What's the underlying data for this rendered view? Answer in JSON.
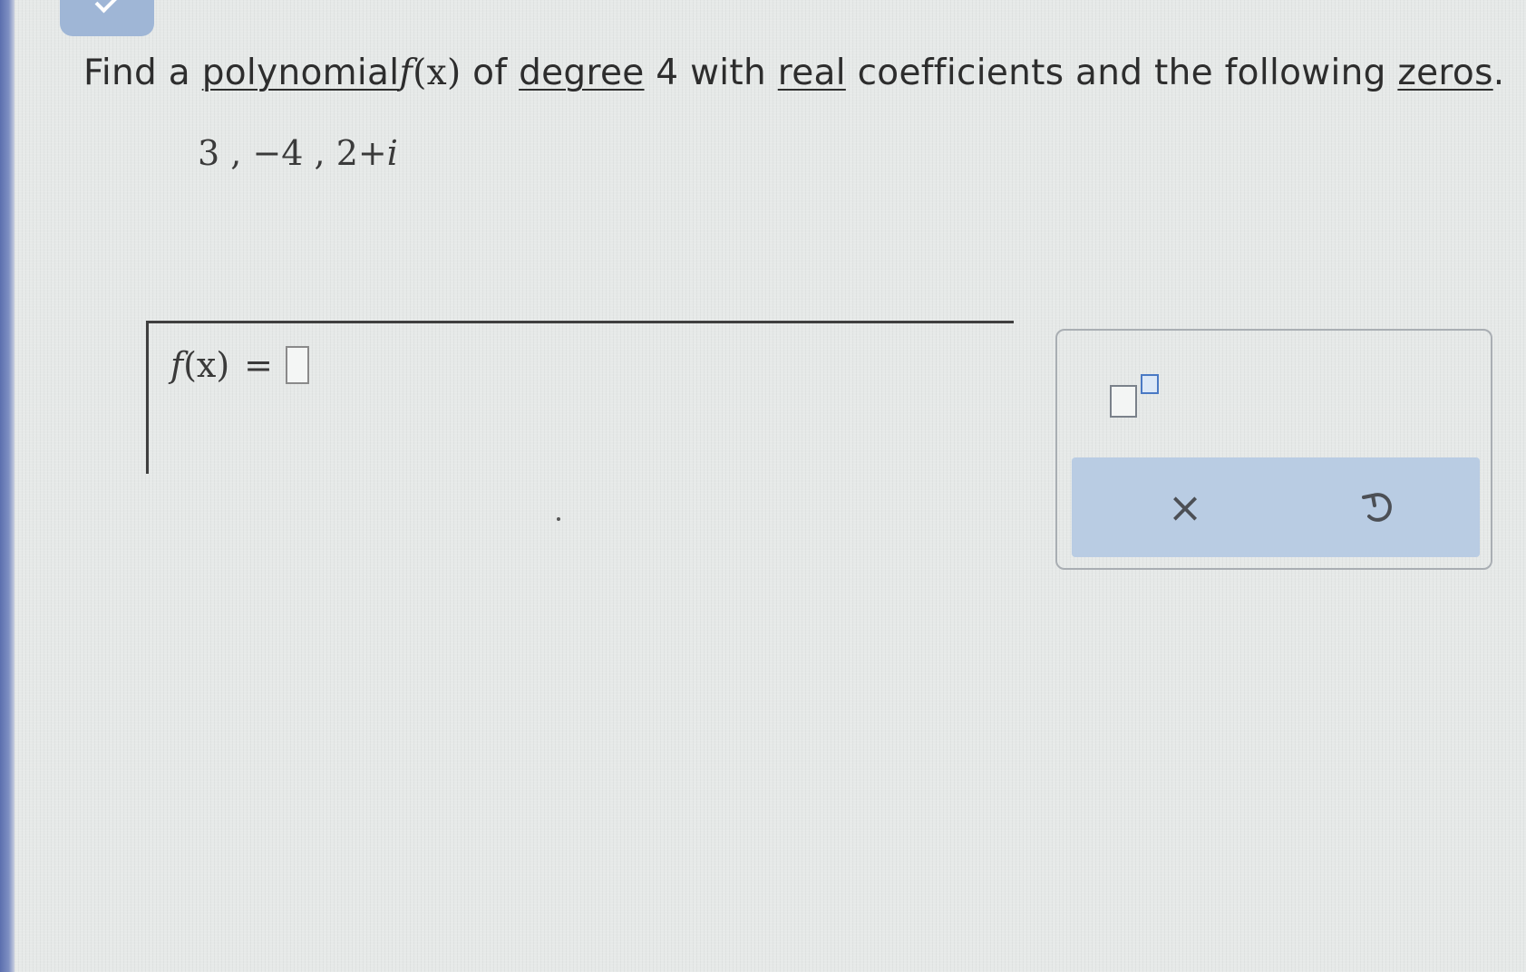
{
  "question": {
    "text_before": "Find a",
    "link_polynomial": "polynomial",
    "func_f": "f",
    "func_x": "(x)",
    "text_of": "of",
    "link_degree": "degree",
    "degree_value": "4",
    "text_with": "with",
    "link_real": "real",
    "text_coeffs": "coefficients and the following",
    "link_zeros": "zeros",
    "period": "."
  },
  "zeros": {
    "z1": "3",
    "sep1": " ,  ",
    "z2": "−4",
    "sep2": " ,  ",
    "z3_real": "2+",
    "z3_imag": "i"
  },
  "answer": {
    "func_f": "f",
    "func_paren": "(x)",
    "equals": "=",
    "input_value": ""
  },
  "toolbox": {
    "clear_symbol": "×",
    "buttons": [
      "exponent-template",
      "clear",
      "undo"
    ]
  },
  "colors": {
    "background": "#e6e9e8",
    "accent": "#b9cce3",
    "left_edge": "#5b6fae"
  }
}
